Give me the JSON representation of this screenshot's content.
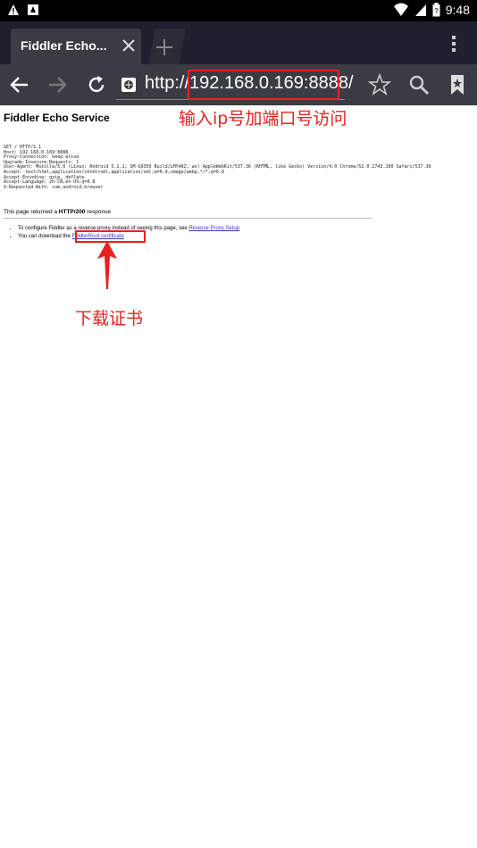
{
  "status_bar": {
    "time": "9:48",
    "icons": [
      "warning-icon",
      "download-icon",
      "wifi-icon",
      "signal-icon",
      "battery-icon"
    ]
  },
  "tab": {
    "title": "Fiddler Echo..."
  },
  "address_bar": {
    "url": "http://192.168.0.169:8888/"
  },
  "page": {
    "title": "Fiddler Echo Service",
    "request_headers": "GET / HTTP/1.1\nHost: 192.168.0.169:8888\nProxy-Connection: keep-alive\nUpgrade-Insecure-Requests: 1\nUser-Agent: Mozilla/5.0 (Linux; Android 5.1.1; SM-G9350 Build/LMY48Z; wv) AppleWebKit/537.36 (KHTML, like Gecko) Version/4.0 Chrome/52.0.2743.100 Safari/537.36\nAccept: text/html,application/xhtml+xml,application/xml;q=0.9,image/webp,*/*;q=0.8\nAccept-Encoding: gzip, deflate\nAccept-Language: zh-CN,en-US;q=0.8\nX-Requested-With: com.android.browser",
    "status_prefix": "This page returned a ",
    "status_code": "HTTP/200",
    "status_suffix": " response",
    "bullet1_text": "To configure Fiddler as a reverse proxy instead of seeing this page, see ",
    "bullet1_link": "Reverse Proxy Setup",
    "bullet2_text": "You can download the ",
    "bullet2_link": "FiddlerRoot certificate"
  },
  "annotations": {
    "url_hint": "输入ip号加端口号访问",
    "cert_hint": "下载证书",
    "color": "#e8211f"
  }
}
